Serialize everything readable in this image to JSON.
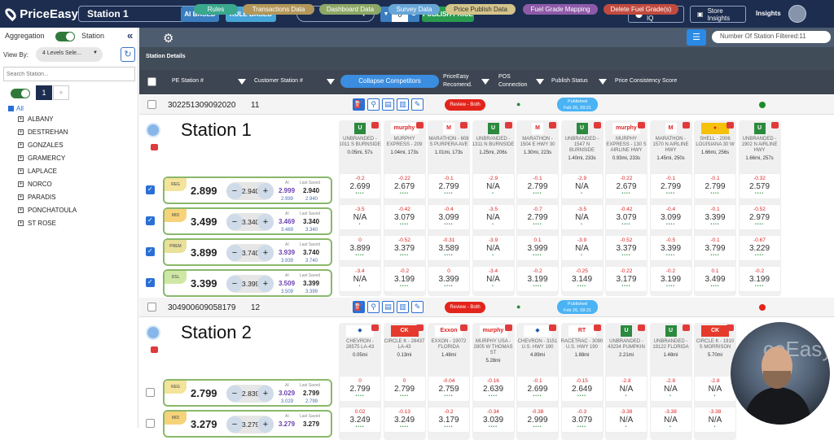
{
  "app": {
    "brand": "PriceEasy",
    "station_selected": "Station 1",
    "ai_based": "AI BASED",
    "rule_based": "RULE BASED",
    "stepper_value": "0",
    "publish_price": "PUBLISH PRICE",
    "location_iq": "Location IQ",
    "store_insights": "Store Insights",
    "insights": "Insights"
  },
  "sidebar": {
    "aggregation": "Aggregation",
    "station": "Station",
    "view_by": "View By:",
    "view_by_value": "4 Levels Sele...",
    "search_placeholder": "Search Station...",
    "page1": "1",
    "page2": "+",
    "all": "All",
    "items": [
      "ALBANY",
      "DESTREHAN",
      "GONZALES",
      "GRAMERCY",
      "LAPLACE",
      "NORCO",
      "PARADIS",
      "PONCHATOULA",
      "ST ROSE"
    ]
  },
  "toolbar": {
    "rules": "Rules",
    "transactions": "Transactions Data",
    "dashboard": "Dashboard Data",
    "survey": "Survey Data",
    "price_publish": "Price Publish Data",
    "fuel_grade_mapping": "Fuel Grade Mapping",
    "delete_fuel_grade": "Delete Fuel Grade(s)",
    "filter_count": "Number Of Station Filtered:11"
  },
  "details_title": "Station Details",
  "columns": {
    "pe_station": "PE Station #",
    "customer_station": "Customer Station #",
    "collapse": "Collapse Competitors",
    "recommend_l1": "PriceEasy",
    "recommend_l2": "Recomend.",
    "pos_l1": "POS",
    "pos_l2": "Connection",
    "publish_status": "Publish Status",
    "consistency": "Price Consistency Score"
  },
  "colors": {
    "nav": "#1c2d4f",
    "ai_btn": "#3b7ec0",
    "rule_btn": "#48a5d8",
    "publish_btn": "#2a9a4f",
    "rules_pill": "#3aa88c",
    "transactions_pill": "#b3975a",
    "dashboard_pill": "#8da866",
    "survey_pill": "#68a6d6",
    "price_publish_pill": "#d4c48a",
    "fuel_grade_pill": "#8e5aa8",
    "delete_pill": "#c14a3f",
    "review": "#e3241b",
    "published": "#4ab3f4",
    "consistency_green": "#1f8a2c",
    "consistency_red": "#e3241b"
  },
  "stations": [
    {
      "pe_id": "302251309092020",
      "cust_id": "11",
      "title": "Station 1",
      "review": "Review - Both",
      "published_l1": "Published",
      "published_l2": "Feb 26, 09:21",
      "consistency": "green",
      "fuels": [
        {
          "grade": "REG",
          "price": "2.899",
          "step": "2.940",
          "ai": "2.999",
          "saved": "2.940",
          "ai_s": "2.999",
          "saved_s": "2.940",
          "checked": true
        },
        {
          "grade": "MID",
          "price": "3.499",
          "step": "3.340",
          "ai": "3.469",
          "saved": "3.340",
          "ai_s": "3.469",
          "saved_s": "3.340",
          "checked": true
        },
        {
          "grade": "PREM",
          "price": "3.899",
          "step": "3.740",
          "ai": "3.939",
          "saved": "3.740",
          "ai_s": "3.939",
          "saved_s": "3.740",
          "checked": true
        },
        {
          "grade": "DSL",
          "price": "3.399",
          "step": "3.399",
          "ai": "3.509",
          "saved": "3.399",
          "ai_s": "3.509",
          "saved_s": "3.399",
          "checked": true
        }
      ],
      "competitors": [
        {
          "brand": "U",
          "name": "UNBRANDED - 1011 S BURNSIDE",
          "dist": "0.05mi, 57s",
          "cells": [
            [
              "-0.2",
              "2.699"
            ],
            [
              "-3.5",
              "N/A"
            ],
            [
              "0",
              "3.899"
            ],
            [
              "-3.4",
              "N/A"
            ]
          ]
        },
        {
          "brand": "MURPHY",
          "name": "MURPHY EXPRESS - 209",
          "dist": "1.04mi, 173s",
          "cells": [
            [
              "-0.22",
              "2.679"
            ],
            [
              "-0.42",
              "3.079"
            ],
            [
              "-0.52",
              "3.379"
            ],
            [
              "-0.2",
              "3.199"
            ]
          ]
        },
        {
          "brand": "M",
          "name": "MARATHON - 608 S PURPERA AVE",
          "dist": "1.01mi, 173s",
          "cells": [
            [
              "-0.1",
              "2.799"
            ],
            [
              "-0.4",
              "3.099"
            ],
            [
              "-0.31",
              "3.589"
            ],
            [
              "0",
              "3.399"
            ]
          ]
        },
        {
          "brand": "U",
          "name": "UNBRANDED - 1311 N BURNSIDE",
          "dist": "1.25mi, 206s",
          "cells": [
            [
              "-2.9",
              "N/A"
            ],
            [
              "-3.5",
              "N/A"
            ],
            [
              "-3.9",
              "N/A"
            ],
            [
              "-3.4",
              "N/A"
            ]
          ]
        },
        {
          "brand": "M",
          "name": "MARATHON - 1504 E HWY 30",
          "dist": "1.30mi, 223s",
          "cells": [
            [
              "-0.1",
              "2.799"
            ],
            [
              "-0.7",
              "2.799"
            ],
            [
              "0.1",
              "3.999"
            ],
            [
              "-0.2",
              "3.199"
            ]
          ]
        },
        {
          "brand": "U",
          "name": "UNBRANDED - 1547 N BURNSIDE",
          "dist": "1.40mi, 233s",
          "cells": [
            [
              "-2.9",
              "N/A"
            ],
            [
              "-3.5",
              "N/A"
            ],
            [
              "-3.9",
              "N/A"
            ],
            [
              "-0.25",
              "3.149"
            ]
          ]
        },
        {
          "brand": "MURPHY",
          "name": "MURPHY EXPRESS - 130 S AIRLINE HWY",
          "dist": "0.93mi, 233s",
          "cells": [
            [
              "-0.22",
              "2.679"
            ],
            [
              "-0.42",
              "3.079"
            ],
            [
              "-0.52",
              "3.379"
            ],
            [
              "-0.22",
              "3.179"
            ]
          ]
        },
        {
          "brand": "M",
          "name": "MARATHON - 1570 N AIRLINE HWY",
          "dist": "1.45mi, 250s",
          "cells": [
            [
              "-0.1",
              "2.799"
            ],
            [
              "-0.4",
              "3.099"
            ],
            [
              "-0.5",
              "3.399"
            ],
            [
              "-0.2",
              "3.199"
            ]
          ]
        },
        {
          "brand": "SHELL",
          "name": "SHELL - 2006 LOUISIANA 30 W",
          "dist": "1.66mi, 256s",
          "cells": [
            [
              "-0.1",
              "2.799"
            ],
            [
              "-0.1",
              "3.399"
            ],
            [
              "-0.1",
              "3.799"
            ],
            [
              "0.1",
              "3.499"
            ]
          ]
        },
        {
          "brand": "U",
          "name": "UNBRANDED - 1902 N AIRLINE HWY",
          "dist": "1.66mi, 257s",
          "cells": [
            [
              "-0.32",
              "2.579"
            ],
            [
              "-0.52",
              "2.979"
            ],
            [
              "-0.67",
              "3.229"
            ],
            [
              "-0.2",
              "3.199"
            ]
          ]
        }
      ]
    },
    {
      "pe_id": "304900609058179",
      "cust_id": "12",
      "title": "Station 2",
      "review": "Review - Both",
      "published_l1": "Published",
      "published_l2": "Feb 26, 09:21",
      "consistency": "red",
      "fuels": [
        {
          "grade": "REG",
          "price": "2.799",
          "step": "2.839",
          "ai": "3.029",
          "saved": "2.799",
          "ai_s": "3.029",
          "saved_s": "2.799",
          "checked": false
        },
        {
          "grade": "MID",
          "price": "3.279",
          "step": "3.279",
          "ai": "3.279",
          "saved": "3.279",
          "ai_s": "",
          "saved_s": "",
          "checked": false
        }
      ],
      "competitors": [
        {
          "brand": "CHEVRON",
          "name": "CHEVRON - 28575 LA-43",
          "dist": "0.05mi",
          "cells": [
            [
              "0",
              "2.799"
            ],
            [
              "0.02",
              "3.249"
            ]
          ]
        },
        {
          "brand": "CIRCLE K",
          "name": "CIRCLE K - 28437 LA-43",
          "dist": "0.13mi",
          "cells": [
            [
              "0",
              "2.799"
            ],
            [
              "-0.13",
              "3.249"
            ]
          ]
        },
        {
          "brand": "EXXON",
          "name": "EXXON - 19072 FLORIDA",
          "dist": "1.48mi",
          "cells": [
            [
              "-0.04",
              "2.759"
            ],
            [
              "-0.2",
              "3.179"
            ]
          ]
        },
        {
          "brand": "MURPHY",
          "name": "MURPHY USA - 2805 W THOMAS ST",
          "dist": "5.28mi",
          "cells": [
            [
              "-0.16",
              "2.639"
            ],
            [
              "-0.34",
              "3.039"
            ]
          ]
        },
        {
          "brand": "CHEVRON",
          "name": "CHEVRON - 3151 U.S. HWY 190",
          "dist": "4.89mi",
          "cells": [
            [
              "-0.1",
              "2.699"
            ],
            [
              "-0.38",
              "2.999"
            ]
          ]
        },
        {
          "brand": "RACETRAC",
          "name": "RACETRAC - 3090 U.S. HWY 190",
          "dist": "1.88mi",
          "cells": [
            [
              "-0.15",
              "2.649"
            ],
            [
              "-0.3",
              "3.079"
            ]
          ]
        },
        {
          "brand": "U",
          "name": "UNBRANDED - 43234 PUMPKIN",
          "dist": "2.21mi",
          "cells": [
            [
              "-2.8",
              "N/A"
            ],
            [
              "-3.38",
              "N/A"
            ]
          ]
        },
        {
          "brand": "U",
          "name": "UNBRANDED - 19122 FLORIDA",
          "dist": "1.48mi",
          "cells": [
            [
              "-2.8",
              "N/A"
            ],
            [
              "-3.38",
              "N/A"
            ]
          ]
        },
        {
          "brand": "CIRCLE K",
          "name": "CIRCLE K - 1910 S MORRISON",
          "dist": "5.70mi",
          "cells": [
            [
              "-2.8",
              "N/A"
            ],
            [
              "-3.38",
              "N/A"
            ]
          ]
        }
      ]
    }
  ],
  "webcam_text": "ceEasy"
}
